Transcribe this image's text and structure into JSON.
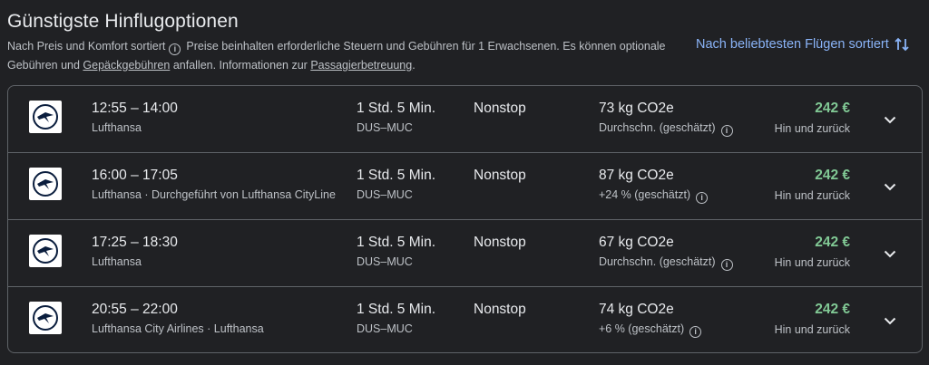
{
  "header": {
    "title": "Günstigste Hinflugoptionen",
    "sorted_by": "Nach Preis und Komfort sortiert",
    "info_text_1": "Preise beinhalten erforderliche Steuern und Gebühren für 1 Erwachsenen. Es können optionale Gebühren und",
    "baggage_link": "Gepäckgebühren",
    "info_text_2": "anfallen. Informationen zur",
    "assistance_link": "Passagierbetreuung",
    "info_text_3": ".",
    "sort_button": "Nach beliebtesten Flügen sortiert"
  },
  "flights": [
    {
      "times": "12:55 – 14:00",
      "airline": "Lufthansa",
      "duration": "1 Std. 5 Min.",
      "route": "DUS–MUC",
      "stops": "Nonstop",
      "co2": "73 kg CO2e",
      "co2_note": "Durchschn. (geschätzt)",
      "price": "242 €",
      "price_note": "Hin und zurück"
    },
    {
      "times": "16:00 – 17:05",
      "airline": "Lufthansa · Durchgeführt von Lufthansa CityLine",
      "duration": "1 Std. 5 Min.",
      "route": "DUS–MUC",
      "stops": "Nonstop",
      "co2": "87 kg CO2e",
      "co2_note": "+24 % (geschätzt)",
      "price": "242 €",
      "price_note": "Hin und zurück"
    },
    {
      "times": "17:25 – 18:30",
      "airline": "Lufthansa",
      "duration": "1 Std. 5 Min.",
      "route": "DUS–MUC",
      "stops": "Nonstop",
      "co2": "67 kg CO2e",
      "co2_note": "Durchschn. (geschätzt)",
      "price": "242 €",
      "price_note": "Hin und zurück"
    },
    {
      "times": "20:55 – 22:00",
      "airline": "Lufthansa City Airlines · Lufthansa",
      "duration": "1 Std. 5 Min.",
      "route": "DUS–MUC",
      "stops": "Nonstop",
      "co2": "74 kg CO2e",
      "co2_note": "+6 % (geschätzt)",
      "price": "242 €",
      "price_note": "Hin und zurück"
    }
  ],
  "icons": {
    "info": "info-icon",
    "sort": "sort-arrows-icon",
    "logo": "lufthansa-crane-logo",
    "expand": "chevron-down-icon"
  },
  "colors": {
    "background": "#202124",
    "price_green": "#81c995",
    "link_blue": "#8ab4f8",
    "border": "#5f6368"
  }
}
